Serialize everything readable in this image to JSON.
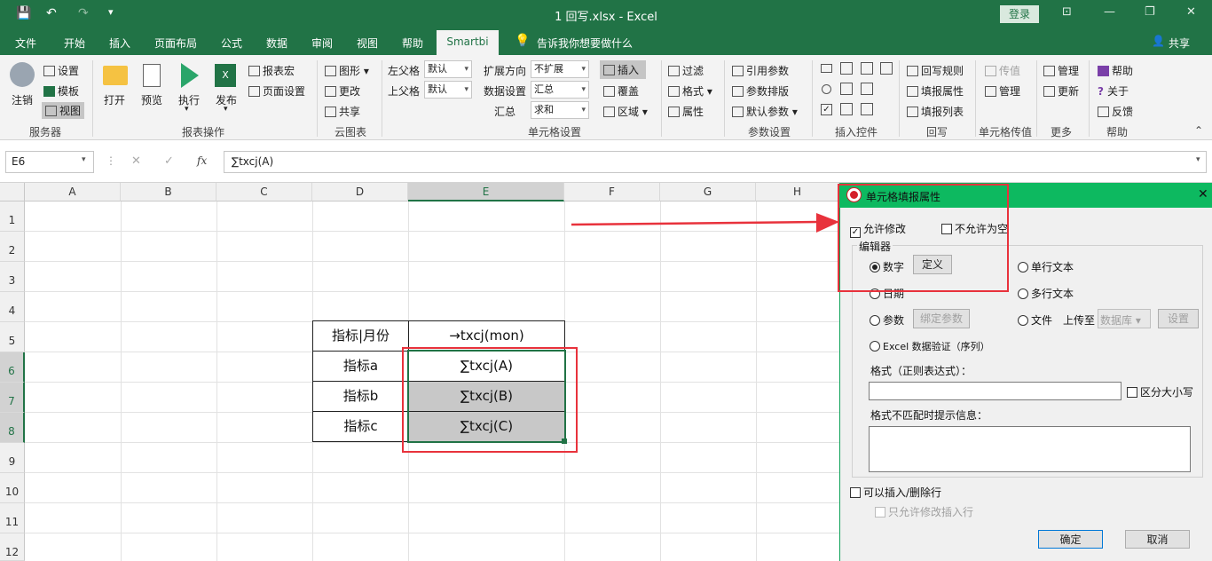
{
  "titlebar": {
    "doc_title": "1 回写.xlsx  -  Excel",
    "login": "登录"
  },
  "quick_access": {
    "save": "💾",
    "undo": "↶",
    "redo": "↷",
    "customize": "▾"
  },
  "window_controls": {
    "ribbon_opts": "⊡",
    "minimize": "—",
    "restore": "❐",
    "close": "✕"
  },
  "menu": {
    "file": "文件",
    "home": "开始",
    "insert": "插入",
    "layout": "页面布局",
    "formula": "公式",
    "data": "数据",
    "review": "审阅",
    "view": "视图",
    "help": "帮助",
    "smartbi": "Smartbi",
    "tell": "告诉我你想要做什么",
    "share": "共享"
  },
  "ribbon": {
    "server": {
      "logout": "注销",
      "settings": "设置",
      "template": "模板",
      "view": "视图",
      "group": "服务器"
    },
    "report_ops": {
      "open": "打开",
      "preview": "预览",
      "execute": "执行",
      "publish": "发布",
      "macro": "报表宏",
      "page_setup": "页面设置",
      "group": "报表操作"
    },
    "cloud": {
      "graph": "图形",
      "change": "更改",
      "share": "共享",
      "group": "云图表"
    },
    "cell_settings": {
      "left_parent": "左父格",
      "up_parent": "上父格",
      "left_val": "默认",
      "up_val": "默认",
      "expand": "扩展方向",
      "expand_val": "不扩展",
      "data_set": "数据设置",
      "data_val": "汇总",
      "summary": "汇总",
      "summary_val": "求和",
      "insert": "插入",
      "cover": "覆盖",
      "area": "区域",
      "group": "单元格设置"
    },
    "filter": {
      "filter": "过滤",
      "format": "格式",
      "attribute": "属性"
    },
    "param": {
      "ref": "引用参数",
      "layout": "参数排版",
      "default": "默认参数",
      "group": "参数设置"
    },
    "controls": {
      "group": "插入控件"
    },
    "writeback": {
      "rule": "回写规则",
      "attr": "填报属性",
      "list": "填报列表",
      "group": "回写"
    },
    "transfer": {
      "value": "传值",
      "manage": "管理",
      "group": "单元格传值"
    },
    "more": {
      "manage": "管理",
      "update": "更新",
      "group": "更多"
    },
    "help": {
      "help": "帮助",
      "about": "关于",
      "feedback": "反馈",
      "group": "帮助"
    }
  },
  "formula_bar": {
    "namebox": "E6",
    "cancel": "✕",
    "enter": "✓",
    "fx": "fx",
    "formula": "∑txcj(A)"
  },
  "sheet": {
    "cols": [
      "A",
      "B",
      "C",
      "D",
      "E",
      "F",
      "G",
      "H"
    ],
    "rows": [
      "1",
      "2",
      "3",
      "4",
      "5",
      "6",
      "7",
      "8",
      "9",
      "10",
      "11",
      "12"
    ],
    "d5": "指标|月份",
    "e5": "→txcj(mon)",
    "d6": "指标a",
    "e6": "∑txcj(A)",
    "d7": "指标b",
    "e7": "∑txcj(B)",
    "d8": "指标c",
    "e8": "∑txcj(C)"
  },
  "dialog": {
    "title": "单元格填报属性",
    "allow_edit": "允许修改",
    "not_empty": "不允许为空",
    "editor": "编辑器",
    "number": "数字",
    "define": "定义",
    "single_text": "单行文本",
    "date": "日期",
    "multi_text": "多行文本",
    "param": "参数",
    "bind_param": "绑定参数",
    "file": "文件",
    "upload_to": "上传至",
    "upload_val": "数据库",
    "settings": "设置",
    "excel_validation": "Excel 数据验证（序列）",
    "format_label": "格式（正则表达式）：",
    "case_sensitive": "区分大小写",
    "mismatch_label": "格式不匹配时提示信息：",
    "insert_delete": "可以插入/删除行",
    "only_edit_insert": "只允许修改插入行",
    "ok": "确定",
    "cancel": "取消"
  },
  "colors": {
    "excel_green": "#217346",
    "dialog_green": "#0db960",
    "highlight_red": "#e8323c"
  }
}
